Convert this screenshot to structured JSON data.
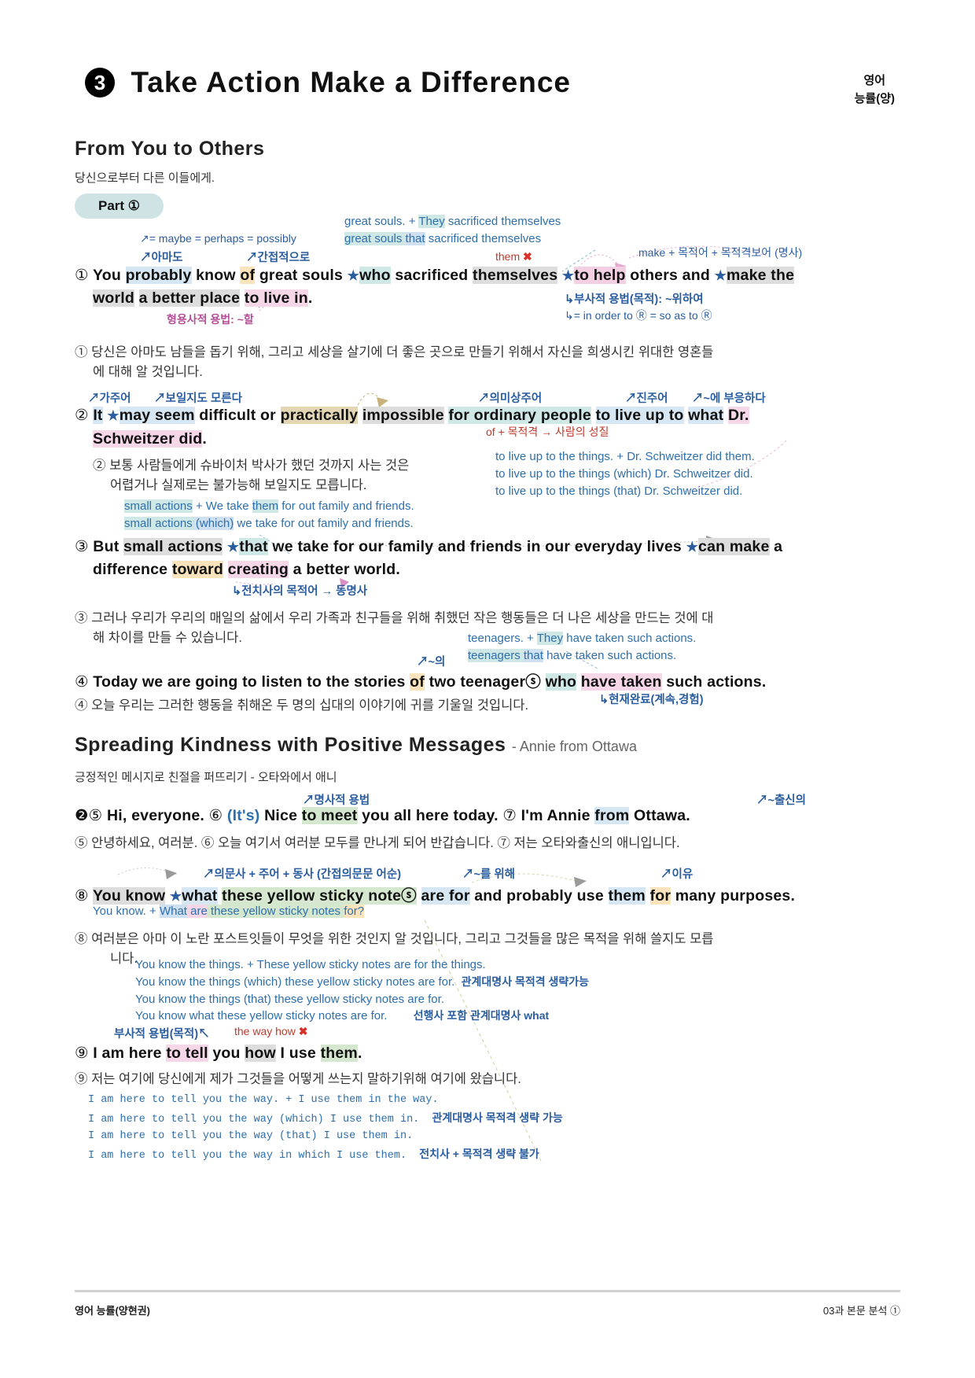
{
  "header": {
    "lesson_number": "3",
    "title": "Take Action Make a Difference",
    "subject": "영어",
    "publisher": "능률(양)"
  },
  "section1": {
    "heading": "From You to Others",
    "heading_kor": "당신으로부터 다른 이들에게.",
    "part_label": "Part ①"
  },
  "s1": {
    "ann_equals": "= maybe = perhaps = possibly",
    "ann_amado": "아마도",
    "ann_indirect": "간접적으로",
    "block_l1_a": "great souls. + ",
    "block_l1_b": "They",
    "block_l1_c": " sacrificed themselves",
    "block_l2_a": "great souls ",
    "block_l2_b": "that",
    "block_l2_c": " sacrificed themselves",
    "them_x": "them",
    "ann_make": "make + 목적어 + 목적격보어 (명사)",
    "en_1": "You probably know of great souls ★who sacrificed themselves ★to help others and ★make the",
    "en_2": "world a better place to live in.",
    "ann_adv": "부사적 용법(목적): ~위하여",
    "ann_inorder": "= in order to Ⓡ = so as to Ⓡ",
    "ann_adj": "형용사적 용법: ~할",
    "kr_1": "당신은 아마도 남들을 돕기 위해, 그리고 세상을 살기에 더 좋은 곳으로 만들기 위해서 자신을 희생시킨 위대한 영혼들",
    "kr_2": "에 대해 알 것입니다."
  },
  "s2": {
    "ann_gajuo": "가주어",
    "ann_boil": "보일지도 모른다",
    "ann_uimi": "의미상주어",
    "ann_jinjuo": "진주어",
    "ann_buheung": "~에 부응하다",
    "en_1": "It ★may seem difficult or practically impossible for ordinary people to live up to what Dr.",
    "en_2": "Schweitzer did.",
    "ann_of": "of + 목적격 → 사람의 성질",
    "kr_1": "보통 사람들에게 슈바이처 박사가 했던 것까지 사는 것은",
    "kr_2": "어렵거나 실제로는 불가능해 보일지도 모릅니다.",
    "blk_1": "to live up to the things. + Dr. Schweitzer did them.",
    "blk_2": "to live up to the things (which) Dr. Schweitzer did.",
    "blk_3": "to live up to the things (that) Dr. Schweitzer did."
  },
  "s3": {
    "blk_1a": "small actions",
    "blk_1b": " + We take ",
    "blk_1c": "them",
    "blk_1d": " for out family and friends.",
    "blk_2a": "small actions",
    "blk_2b": " (which)",
    "blk_2c": " we take  for out family and friends.",
    "en_1": "But small actions ★that we take for our family and friends in our everyday lives ★can make a",
    "en_2": "difference toward creating a better world.",
    "ann_prep": "전치사의 목적어 → 동명사",
    "kr_1": "그러나 우리가 우리의 매일의 삶에서 우리 가족과 친구들을 위해 취했던 작은 행동들은 더 나은 세상을 만드는 것에 대",
    "kr_2": "해 차이를 만들 수 있습니다."
  },
  "s4": {
    "blk_1a": "teenagers. + ",
    "blk_1b": "They",
    "blk_1c": " have taken such actions.",
    "blk_2a": "teenagers ",
    "blk_2b": "that",
    "blk_2c": " have taken such actions.",
    "ann_ui": "~의",
    "en_1": "Today we are going to listen to the stories of two teenagerⓢ who have taken such actions.",
    "kr_1": "오늘 우리는 그러한 행동을 취해온 두 명의 십대의 이야기에 귀를 기울일 것입니다.",
    "ann_perfect": "현재완료(계속,경험)"
  },
  "section2": {
    "heading": "Spreading Kindness with Positive Messages",
    "heading_sub": "- Annie from Ottawa",
    "heading_kor": "긍정적인 메시지로 친절을 퍼뜨리기 - 오타와에서 애니"
  },
  "s5": {
    "ann_noun": "명사적 용법",
    "ann_from": "~출신의",
    "en_1": "❷⑤ Hi, everyone. ⑥ (It's) Nice to meet you all here today. ⑦ I'm Annie from Ottawa.",
    "kr_1": "⑤ 안녕하세요, 여러분. ⑥ 오늘 여기서 여러분 모두를 만나게 되어 반갑습니다. ⑦ 저는 오타와출신의 애니입니다."
  },
  "s8": {
    "ann_order": "의문사 + 주어 + 동사 (간접의문문 어순)",
    "ann_for": "~를 위해",
    "ann_reason": "이유",
    "en_1": "You know ★what these yellow sticky noteⓢ are for and probably use them for many purposes.",
    "blk_top_a": "You know. + ",
    "blk_top_b": "What",
    "blk_top_c": " are",
    "blk_top_d": " these yellow sticky notes ",
    "blk_top_e": "for?",
    "kr_1": "여러분은 아마 이 노란 포스트잇들이 무엇을 위한 것인지 알 것입니다, 그리고 그것들을 많은 목적을 위해 쓸지도 모릅",
    "kr_2": "니다.",
    "blk_1": "You know the things. + These yellow sticky notes are for the things.",
    "blk_2": "You know the things (which) these yellow sticky notes are for.",
    "blk_2_note": "관계대명사 목적격 생략가능",
    "blk_3": "You know the things (that) these yellow sticky notes are for.",
    "blk_4": "You know what these yellow sticky notes are for.",
    "blk_4_note": "선행사 포함 관계대명사 what"
  },
  "s9": {
    "ann_adv": "부사적 용법(목적)",
    "ann_theway": "the way how",
    "en_1": "I am here to tell you how I use them.",
    "kr_1": "저는 여기에 당신에게 제가 그것들을 어떻게 쓰는지 말하기위해 여기에 왔습니다.",
    "blk_1": "I am here to tell you the way. + I use them in the way.",
    "blk_2": "I am here to tell you the way (which) I use them in.",
    "blk_2_note": "관계대명사 목적격 생략 가능",
    "blk_3": "I am here to tell you the way (that) I use them in.",
    "blk_4": "I am here to tell you the way in which I use them.",
    "blk_4_note": "전치사 + 목적격 생략 불가"
  },
  "footer": {
    "left": "영어 능률(양현권)",
    "right": "03과 본문 분석 ①"
  },
  "colors": {
    "accent_blue": "#2a5d9f",
    "pill_bg": "#cfe3e4",
    "red": "#c0392b",
    "pink": "#b34f97"
  }
}
